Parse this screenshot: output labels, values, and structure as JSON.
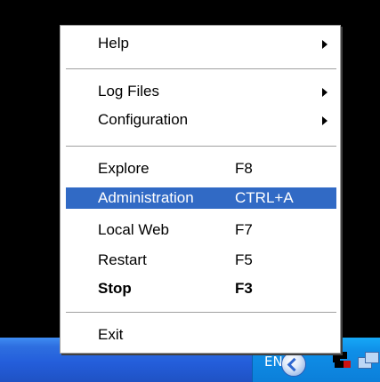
{
  "menu": {
    "items": [
      {
        "label": "Help",
        "shortcut": "",
        "submenu": true
      },
      {
        "label": "Log Files",
        "shortcut": "",
        "submenu": true
      },
      {
        "label": "Configuration",
        "shortcut": "",
        "submenu": true
      },
      {
        "label": "Explore",
        "shortcut": "F8",
        "submenu": false
      },
      {
        "label": "Administration",
        "shortcut": "CTRL+A",
        "submenu": false,
        "selected": true
      },
      {
        "label": "Local Web",
        "shortcut": "F7",
        "submenu": false
      },
      {
        "label": "Restart",
        "shortcut": "F5",
        "submenu": false
      },
      {
        "label": "Stop",
        "shortcut": "F3",
        "submenu": false,
        "bold": true
      },
      {
        "label": "Exit",
        "shortcut": "",
        "submenu": false
      }
    ]
  },
  "taskbar": {
    "language": "EN",
    "tray_icons": [
      "back-arrow-icon",
      "app-server-icon",
      "network-icon"
    ]
  },
  "colors": {
    "menu_highlight": "#316ac5",
    "taskbar_blue": "#245edb",
    "tray_blue": "#0f8fe8"
  }
}
